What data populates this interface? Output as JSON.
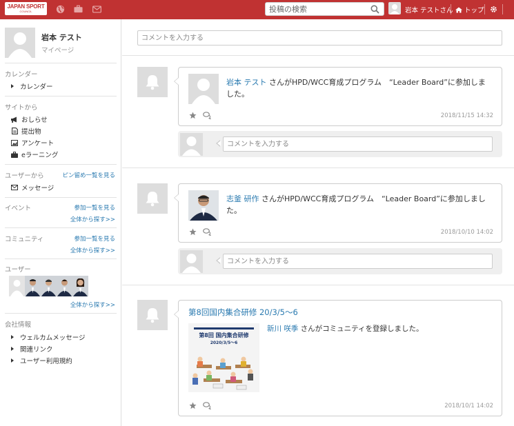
{
  "topbar": {
    "logo_line1": "JAPAN SPORT",
    "logo_line2": "COUNCIL",
    "search_placeholder": "投稿の検索",
    "user_name": "岩本 テストさん",
    "top_link": "トップ",
    "colors": {
      "bar": "#c03232",
      "link": "#2a7ab0"
    }
  },
  "sidebar": {
    "profile_name": "岩本 テスト",
    "profile_sub": "マイページ",
    "calendar_head": "カレンダー",
    "calendar_item": "カレンダー",
    "site_head": "サイトから",
    "site_items": [
      "おしらせ",
      "提出物",
      "アンケート",
      "eラーニング"
    ],
    "user_from_head": "ユーザーから",
    "pin_link": "ピン留め一覧を見る",
    "message_item": "メッセージ",
    "event_head": "イベント",
    "event_link1": "参加一覧を見る",
    "event_link2": "全体から探す>>",
    "community_head": "コミュニティ",
    "community_link1": "参加一覧を見る",
    "community_link2": "全体から探す>>",
    "users_head": "ユーザー",
    "users_link": "全体から探す>>",
    "company_head": "会社情報",
    "company_items": [
      "ウェルカムメッセージ",
      "関連リンク",
      "ユーザー利用規約"
    ]
  },
  "main": {
    "top_comment_placeholder": "コメントを入力する",
    "posts": [
      {
        "name": "岩本 テスト",
        "text": " さんがHPD/WCC育成プログラム　“Leader Board”に参加しました。",
        "date": "2018/11/15 14:32",
        "comment_placeholder": "コメントを入力する"
      },
      {
        "name": "志釜 研作",
        "text": " さんがHPD/WCC育成プログラム　“Leader Board”に参加しました。",
        "date": "2018/10/10 14:02",
        "comment_placeholder": "コメントを入力する"
      },
      {
        "title": "第8回国内集合研修 20/3/5〜6",
        "img_line1": "第8回 国内集合研修",
        "img_line2": "2020/3/5〜6",
        "name": "新川 咲季",
        "text": " さんがコミュニティを登録しました。",
        "date": "2018/10/1 14:02"
      }
    ]
  }
}
